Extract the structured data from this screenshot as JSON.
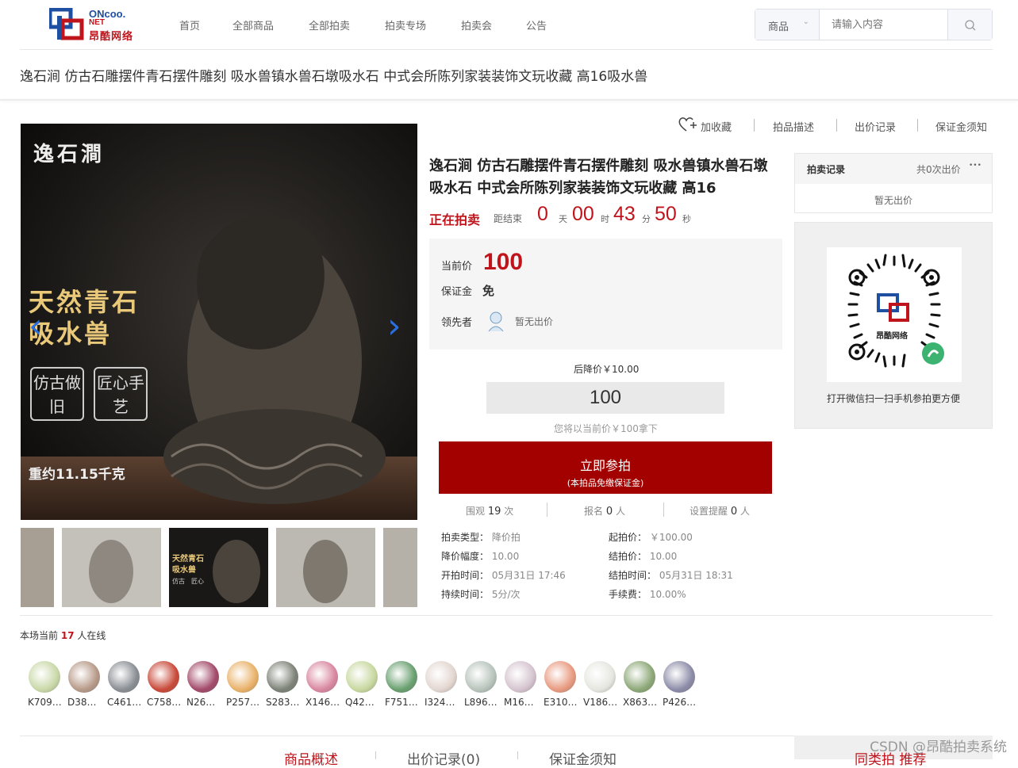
{
  "header": {
    "logo": {
      "top": "ONcoo.",
      "net": "NET",
      "cn": "昂酷网络"
    },
    "nav": [
      "首页",
      "全部商品",
      "全部拍卖",
      "拍卖专场",
      "拍卖会",
      "公告"
    ],
    "search": {
      "category": "商品",
      "placeholder": "请输入内容"
    }
  },
  "page_title": "逸石涧 仿古石雕摆件青石摆件雕刻 吸水兽镇水兽石墩吸水石 中式会所陈列家装装饰文玩收藏 高16吸水兽",
  "image": {
    "brand": "逸石澗",
    "headline1": "天然青石",
    "headline2": "吸水兽",
    "badge1": "仿古做旧",
    "badge2": "匠心手艺",
    "weight": "重约11.15千克",
    "thumb_text1": "天然青石",
    "thumb_text2": "吸水兽",
    "thumb_badge1": "仿古",
    "thumb_badge2": "匠心"
  },
  "top_links": {
    "favorite": "加收藏",
    "desc": "拍品描述",
    "bids": "出价记录",
    "deposit": "保证金须知"
  },
  "product": {
    "title": "逸石涧 仿古石雕摆件青石摆件雕刻 吸水兽镇水兽石墩吸水石 中式会所陈列家装装饰文玩收藏 高16",
    "status": "正在拍卖",
    "countdown_label": "距结束",
    "days": "0",
    "days_unit": "天",
    "hours": "00",
    "hours_unit": "时",
    "minutes": "43",
    "minutes_unit": "分",
    "seconds": "50",
    "seconds_unit": "秒",
    "current_price_label": "当前价",
    "current_price": "100",
    "deposit_label": "保证金",
    "deposit_value": "免",
    "leader_label": "领先者",
    "leader_value": "暂无出价",
    "next_price": "后降价￥10.00",
    "bid_value": "100",
    "hint": "您将以当前价￥100拿下",
    "bid_button": "立即参拍",
    "bid_button_sub": "(本拍品免缴保证金)",
    "views_label": "围观",
    "views": "19",
    "views_unit": "次",
    "signups_label": "报名",
    "signups": "0",
    "signups_unit": "人",
    "reminders_label": "设置提醒",
    "reminders": "0",
    "reminders_unit": "人"
  },
  "params": [
    {
      "label": "拍卖类型：",
      "value": "降价拍"
    },
    {
      "label": "起拍价：",
      "value": "￥100.00"
    },
    {
      "label": "降价幅度：",
      "value": "10.00"
    },
    {
      "label": "结拍价：",
      "value": "10.00"
    },
    {
      "label": "开拍时间：",
      "value": "05月31日 17:46"
    },
    {
      "label": "结拍时间：",
      "value": "05月31日 18:31"
    },
    {
      "label": "持续时间：",
      "value": "5分/次"
    },
    {
      "label": "手续费：",
      "value": "10.00%"
    }
  ],
  "record": {
    "title": "拍卖记录",
    "count": "共0次出价",
    "more": "•••",
    "empty": "暂无出价"
  },
  "qr": {
    "cn": "昂酷网络",
    "caption": "打开微信扫一扫手机参拍更方便"
  },
  "online": {
    "prefix": "本场当前",
    "count": "17",
    "suffix": "人在线"
  },
  "users": [
    {
      "name": "K709…",
      "color": "#c9d8a8"
    },
    {
      "name": "D38…",
      "color": "#b79a88"
    },
    {
      "name": "C461…",
      "color": "#8a8f94"
    },
    {
      "name": "C758…",
      "color": "#c94a3a"
    },
    {
      "name": "N26…",
      "color": "#a34b6a"
    },
    {
      "name": "P257…",
      "color": "#e9b26a"
    },
    {
      "name": "S283…",
      "color": "#7d8378"
    },
    {
      "name": "X146…",
      "color": "#d988a0"
    },
    {
      "name": "Q42…",
      "color": "#c8d8a0"
    },
    {
      "name": "F751…",
      "color": "#6aa070"
    },
    {
      "name": "I324…",
      "color": "#e3d6d0"
    },
    {
      "name": "L896…",
      "color": "#b8c4bc"
    },
    {
      "name": "M16…",
      "color": "#d5c4cf"
    },
    {
      "name": "E310…",
      "color": "#e89a80"
    },
    {
      "name": "V186…",
      "color": "#e6e6e0"
    },
    {
      "name": "X863…",
      "color": "#8da878"
    },
    {
      "name": "P426…",
      "color": "#8c8ca8"
    }
  ],
  "bottom_tabs": [
    "商品概述",
    "出价记录(0)",
    "保证金须知"
  ],
  "bottom_right": "同类拍 推荐",
  "watermark": "CSDN @昂酷拍卖系统",
  "colors": {
    "accent": "#c0141c",
    "button": "#a30000",
    "link": "#2a6fe0"
  }
}
